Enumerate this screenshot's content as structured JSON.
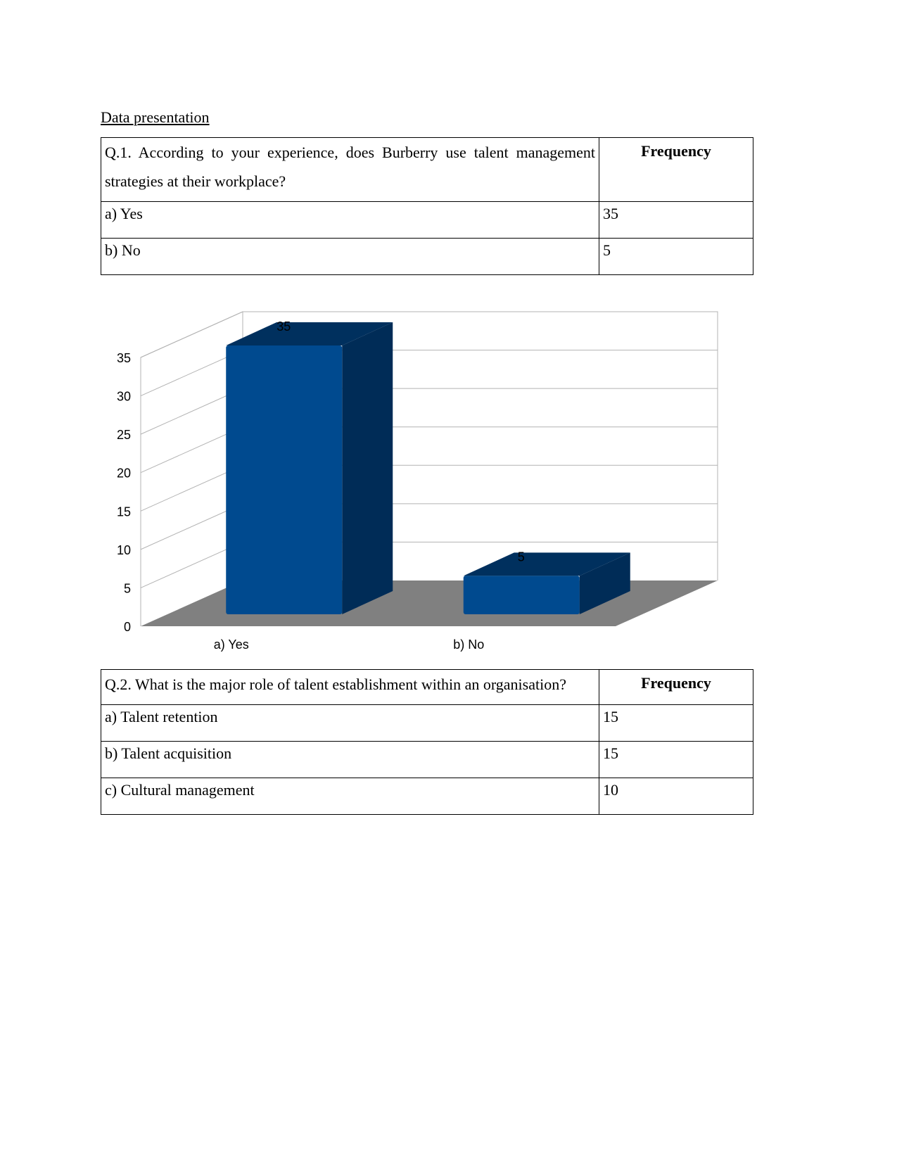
{
  "heading": "Data presentation",
  "q1": {
    "question": "Q.1. According to your experience, does Burberry use talent management strategies at their workplace?",
    "freq_header": "Frequency",
    "options": [
      {
        "label": "a) Yes",
        "value": "35"
      },
      {
        "label": "b) No",
        "value": "5"
      }
    ]
  },
  "q2": {
    "question": "Q.2. What is the major role of talent establishment within an organisation?",
    "freq_header": "Frequency",
    "options": [
      {
        "label": "a) Talent retention",
        "value": "15"
      },
      {
        "label": "b) Talent acquisition",
        "value": "15"
      },
      {
        "label": "c) Cultural management",
        "value": "10"
      }
    ]
  },
  "chart_data": {
    "type": "bar",
    "style": "3d-column",
    "title": "",
    "xlabel": "",
    "ylabel": "",
    "categories": [
      "a) Yes",
      "b) No"
    ],
    "values": [
      35,
      5
    ],
    "data_labels": [
      "35",
      "5"
    ],
    "ylim": [
      0,
      35
    ],
    "yticks": [
      "0",
      "5",
      "10",
      "15",
      "20",
      "25",
      "30",
      "35"
    ],
    "grid": true,
    "legend": "none",
    "colors": {
      "bar_front": "#004a8f",
      "bar_side": "#002c57",
      "bar_top": "#00305e",
      "floor": "#808080",
      "grid": "#b3b3b3"
    }
  }
}
